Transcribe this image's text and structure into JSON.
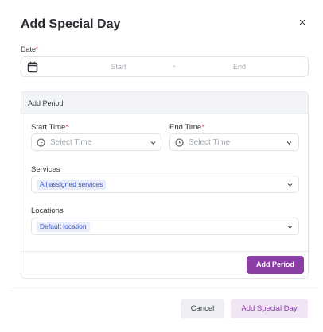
{
  "dialog": {
    "title": "Add Special Day",
    "close_glyph": "×"
  },
  "date": {
    "label": "Date",
    "required_mark": "*",
    "start_placeholder": "Start",
    "separator": "-",
    "end_placeholder": "End",
    "icon": "calendar-icon"
  },
  "period": {
    "title": "Add Period",
    "start_time": {
      "label": "Start Time",
      "required_mark": "*",
      "placeholder": "Select Time",
      "icon": "clock-icon"
    },
    "end_time": {
      "label": "End Time",
      "required_mark": "*",
      "placeholder": "Select Time",
      "icon": "clock-icon"
    },
    "services": {
      "label": "Services",
      "selected": "All assigned services"
    },
    "locations": {
      "label": "Locations",
      "selected": "Default location"
    },
    "add_button": "Add Period"
  },
  "footer": {
    "cancel_label": "Cancel",
    "submit_label": "Add Special Day"
  },
  "colors": {
    "accent": "#8a3ea6",
    "accent_soft": "#f1e4f5",
    "required": "#e0457b",
    "tag_bg": "#e8ecfb",
    "tag_text": "#3c55b8"
  }
}
